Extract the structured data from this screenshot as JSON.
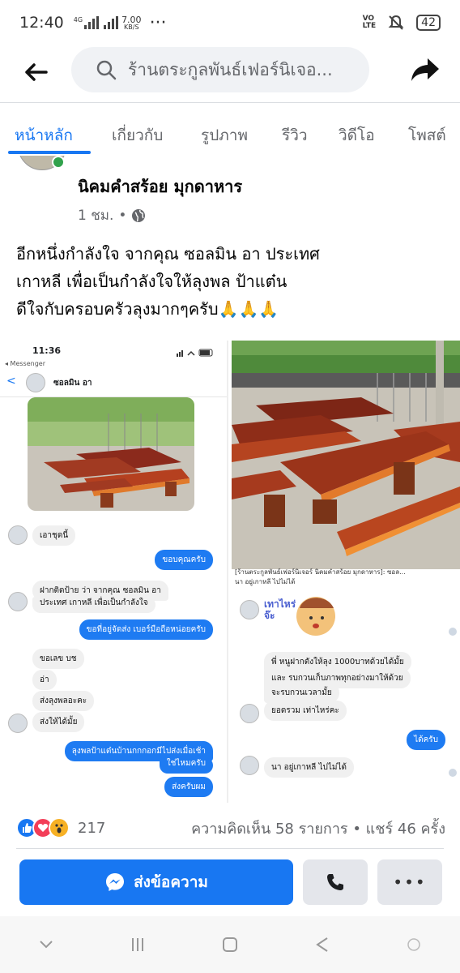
{
  "status": {
    "time": "12:40",
    "network": "4G",
    "speed_value": "7.00",
    "speed_unit": "KB/S",
    "dots": "···",
    "volte_top": "VO",
    "volte_bottom": "LTE",
    "battery": "42"
  },
  "search": {
    "query": "ร้านตระกูลพันธ์เฟอร์นิเจอ..."
  },
  "tabs": [
    {
      "label": "หน้าหลัก",
      "active": true
    },
    {
      "label": "เกี่ยวกับ"
    },
    {
      "label": "รูปภาพ"
    },
    {
      "label": "รีวิว"
    },
    {
      "label": "วิดีโอ"
    },
    {
      "label": "โพสต์"
    }
  ],
  "post": {
    "page_name": "นิคมคำสร้อย มุกดาหาร",
    "time": "1 ชม.",
    "separator": "•",
    "text_lines": [
      "อีกหนึ่งกำลังใจ จากคุณ ซอลมิน อา  ประเทศ",
      "เกาหลี  เพื่อเป็นกำลังใจให้ลุงพล ป้าแต๋น",
      "ดีใจกับครอบครัวลุงมากๆครับ"
    ],
    "emoji": "🙏🙏🙏"
  },
  "screenshot_left": {
    "time": "11:36",
    "app": "◂ Messenger",
    "back": "<",
    "contact": "ซอลมิน อา",
    "messages": [
      {
        "text": "เอาชุดนี้",
        "dir": "in"
      },
      {
        "text": "ขอบคุณครับ",
        "dir": "out"
      },
      {
        "text": "ฝากติดป้าย ว่า จากคุณ ซอลมิน อา",
        "dir": "in"
      },
      {
        "text": "ประเทศ เกาหลี  เพื่อเป็นกำลังใจ",
        "dir": "in"
      },
      {
        "text": "ขอที่อยู่จัดส่ง เบอร์มือถือหน่อยครับ",
        "dir": "out"
      },
      {
        "text": "ขอเลข บช",
        "dir": "in"
      },
      {
        "text": "อ่า",
        "dir": "in"
      },
      {
        "text": "ส่งลุงพลอะคะ",
        "dir": "in"
      },
      {
        "text": "ส่งให้ได้มั้ย",
        "dir": "in"
      },
      {
        "text": "ลุงพลป้าแต๋นบ้านกกกอกมีไปส่งเมื่อเช้า",
        "dir": "out"
      },
      {
        "text": "ใช่ไหมครับ",
        "dir": "out"
      },
      {
        "text": "ส่งครับผม",
        "dir": "out"
      }
    ]
  },
  "screenshot_right": {
    "caption_1": "[ร้านตระกูลพันธ์เฟอร์นิเจอร์ นิคมคำสร้อย มุกดาหาร]: ซอล...",
    "caption_2": "นา อยู่เกาหลี  ไปไม่ได้",
    "sticker_text": "เทาไหร่จ๊ะ",
    "messages": [
      {
        "text": "พี่ หนูฝากตังให้ลุง 1000บาทด้วยได้มั้ย",
        "dir": "in"
      },
      {
        "text": "และ รบกวนเก็บภาพทุกอย่างมาให้ด้วย",
        "dir": "in"
      },
      {
        "text": "จะรบกวนเวลามั้ย",
        "dir": "in"
      },
      {
        "text": "ยอดรวม เท่าไหร่คะ",
        "dir": "in"
      },
      {
        "text": "ได้ครับ",
        "dir": "out"
      },
      {
        "text": "นา อยู่เกาหลี  ไปไม่ได้",
        "dir": "in"
      }
    ]
  },
  "engagement": {
    "reaction_count": "217",
    "summary": "ความคิดเห็น 58 รายการ • แชร์ 46 ครั้ง"
  },
  "actions": {
    "message_label": "ส่งข้อความ",
    "more_label": "•••"
  },
  "colors": {
    "accent": "#1877f2",
    "online": "#31a24c",
    "like": "#1877f2",
    "love": "#f33e58",
    "wow": "#f7b125"
  }
}
